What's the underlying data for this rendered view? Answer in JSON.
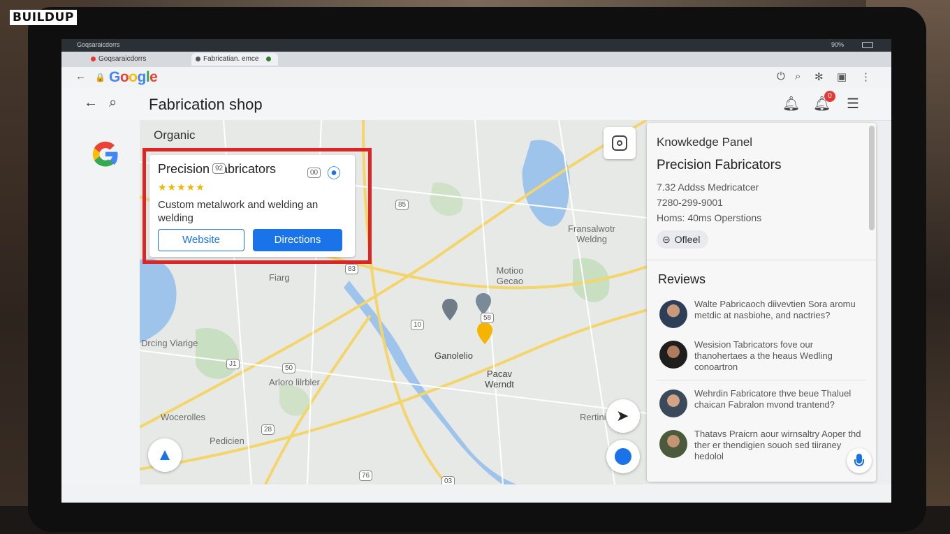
{
  "brand": {
    "logo_text": "BUILDUP"
  },
  "os_bar": {
    "left_text": "Goqsaraicdorrs",
    "right_text": "90%"
  },
  "browser": {
    "tabs": [
      {
        "label": "Goqsaraicdorrs",
        "active": false
      },
      {
        "label": "Fabricatian. emce",
        "active": true
      }
    ],
    "address_logo": "Google"
  },
  "search": {
    "query": "Fabrication shop",
    "notification_count": "0"
  },
  "map": {
    "section_label": "Organic",
    "listing": {
      "name": "Precision Fabricators",
      "rating": "★★★★★",
      "description": "Custom metalwork and welding an welding",
      "website_label": "Website",
      "directions_label": "Directions"
    },
    "labels": [
      "Fransalwotr Weldng",
      "Motioo Gecao",
      "Fiarg",
      "Drcing Viarige",
      "Arloro lilrbler",
      "Ganolelio",
      "Pacav Werndt",
      "Wocerolles",
      "Pedicien",
      "Rertinig"
    ],
    "shields": [
      "00",
      "85",
      "83",
      "10",
      "58",
      "J1",
      "50",
      "28",
      "76",
      "03",
      "92"
    ]
  },
  "knowledge_panel": {
    "heading": "Knowkedge Panel",
    "name": "Precision Fabricators",
    "address": "7.32 Addss Medricatcer",
    "phone": "7280-299-9001",
    "hours": "Homs: 40ms Operstions",
    "chip_label": "Ofleel",
    "reviews_heading": "Reviews",
    "reviews": [
      {
        "name": "Walte Pabricaoch",
        "text": "Walte Pabricaoch diivevtien Sora aromu metdic at nasbiohe, and nactries?"
      },
      {
        "name": "Wesision Tabricators",
        "text": "Wesision Tabricators fove our thanohertaes a the heaus Wedling conoartron"
      },
      {
        "name": "Wehrdin Fabricatore",
        "text": "Wehrdin Fabricatore thve beue Thaluel chaican Fabralon mvond trantend?"
      },
      {
        "name": "Thatavs Praicrn",
        "text": "Thatavs Praicrn aour wirnsaltry Aoper thd ther er thendigien souoh sed tiiraney hedolol"
      }
    ]
  },
  "colors": {
    "accent_blue": "#1a73e8",
    "highlight_red": "#e02424",
    "star_yellow": "#f4b400",
    "notification_red": "#e53935"
  }
}
